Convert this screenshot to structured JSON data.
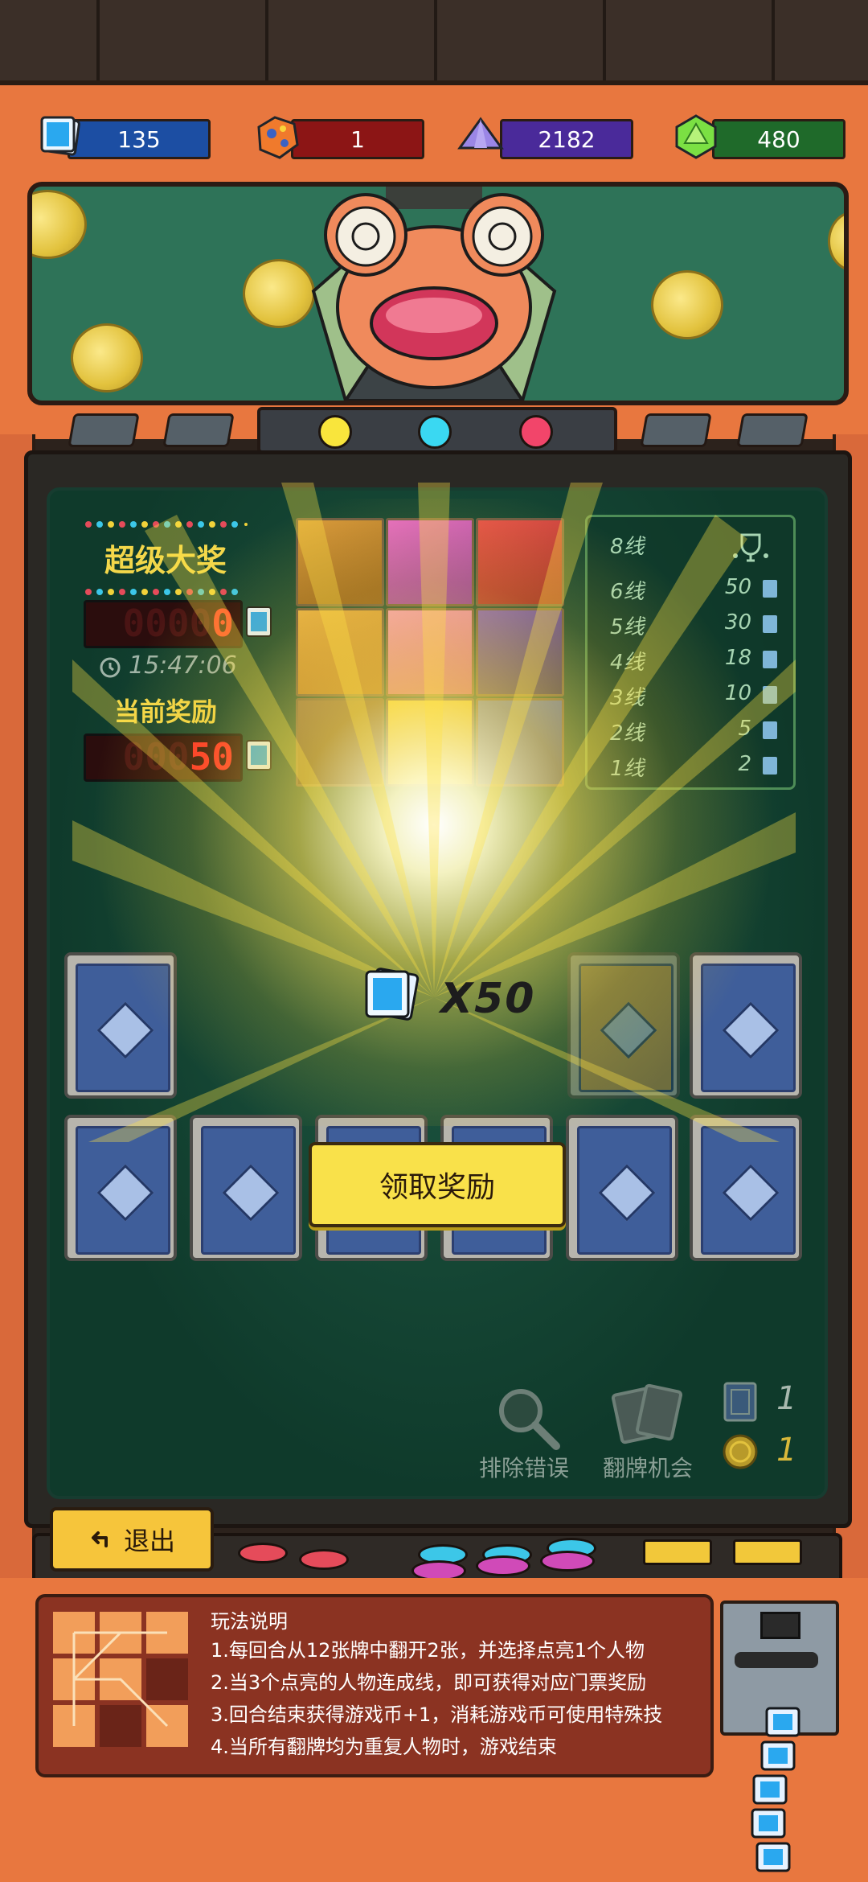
{
  "currencies": [
    {
      "name": "ticket",
      "value": "135",
      "color": "#1c4ea3"
    },
    {
      "name": "ore",
      "value": "1",
      "color": "#8c1515"
    },
    {
      "name": "crystal",
      "value": "2182",
      "color": "#4a2a9a"
    },
    {
      "name": "gem",
      "value": "480",
      "color": "#1f6a2a"
    }
  ],
  "jackpot": {
    "title": "超级大奖",
    "value": "0",
    "timer": "15:47:06",
    "current_label": "当前奖励",
    "current_value": "50"
  },
  "paytable": [
    {
      "line": "8线",
      "reward": "",
      "icon": "trophy-icon"
    },
    {
      "line": "6线",
      "reward": "50"
    },
    {
      "line": "5线",
      "reward": "30"
    },
    {
      "line": "4线",
      "reward": "18"
    },
    {
      "line": "3线",
      "reward": "10"
    },
    {
      "line": "2线",
      "reward": "5"
    },
    {
      "line": "1线",
      "reward": "2"
    }
  ],
  "reward_popup": {
    "multiplier": "X50",
    "claim_label": "领取奖励"
  },
  "tools": [
    {
      "label": "排除错误",
      "icon": "magnifier-icon"
    },
    {
      "label": "翻牌机会",
      "icon": "cards-icon"
    }
  ],
  "counters": [
    {
      "icon": "card-icon",
      "value": "1"
    },
    {
      "icon": "coin-icon",
      "value": "1"
    }
  ],
  "exit_label": "退出",
  "instructions": {
    "title": "玩法说明",
    "lines": [
      "1.每回合从12张牌中翻开2张，并选择点亮1个人物",
      "2.当3个点亮的人物连成线，即可获得对应门票奖励",
      "3.回合结束获得游戏币+1，消耗游戏币可使用特殊技",
      "4.当所有翻牌均为重复人物时，游戏结束"
    ]
  },
  "colors": {
    "cabinet": "#e8773f",
    "board": "#1f5a44",
    "button_yellow": "#f9e14a",
    "led_red": "#ff2a2a"
  }
}
